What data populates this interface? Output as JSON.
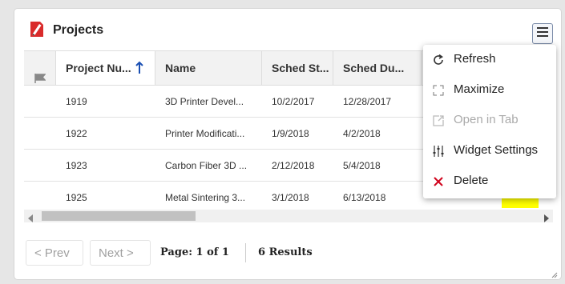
{
  "widget": {
    "title": "Projects",
    "logo_icon": "red-pencil-logo-icon",
    "menu_icon": "hamburger-menu-icon"
  },
  "grid": {
    "columns": [
      {
        "key": "flag",
        "label": "",
        "icon": "flag-icon"
      },
      {
        "key": "number",
        "label": "Project Nu...",
        "sort": "ascending",
        "sort_icon": "arrow-up-icon"
      },
      {
        "key": "name",
        "label": "Name"
      },
      {
        "key": "sched_start",
        "label": "Sched St..."
      },
      {
        "key": "sched_due",
        "label": "Sched Du..."
      }
    ],
    "rows": [
      {
        "number": "1919",
        "name": "3D Printer Devel...",
        "sched_start": "10/2/2017",
        "sched_due": "12/28/2017"
      },
      {
        "number": "1922",
        "name": "Printer Modificati...",
        "sched_start": "1/9/2018",
        "sched_due": "4/2/2018"
      },
      {
        "number": "1923",
        "name": "Carbon Fiber 3D ...",
        "sched_start": "2/12/2018",
        "sched_due": "5/4/2018"
      },
      {
        "number": "1925",
        "name": "Metal Sintering 3...",
        "sched_start": "3/1/2018",
        "sched_due": "6/13/2018"
      }
    ]
  },
  "pager": {
    "prev_label": "< Prev",
    "next_label": "Next >",
    "page_info": "Page: 1 of 1",
    "results": "6 Results"
  },
  "menu": {
    "items": [
      {
        "label": "Refresh",
        "icon": "refresh-icon",
        "enabled": true
      },
      {
        "label": "Maximize",
        "icon": "maximize-icon",
        "enabled": true
      },
      {
        "label": "Open in Tab",
        "icon": "open-in-tab-icon",
        "enabled": false
      },
      {
        "label": "Widget Settings",
        "icon": "sliders-icon",
        "enabled": true
      },
      {
        "label": "Delete",
        "icon": "delete-x-icon",
        "enabled": true,
        "icon_color": "#d0021b"
      }
    ]
  },
  "colors": {
    "accent_blue": "#1a4fb3",
    "logo_red": "#d92b2b",
    "delete_red": "#d0021b",
    "highlight_yellow": "#ffff00"
  }
}
